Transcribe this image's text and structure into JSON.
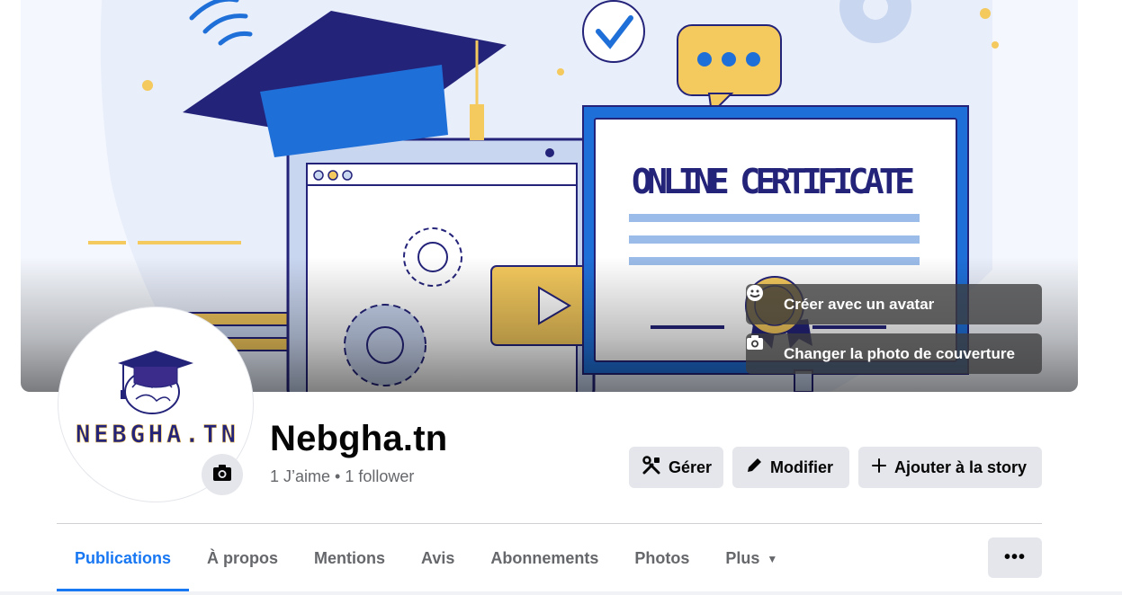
{
  "cover": {
    "certificate_title": "ONLINE CERTIFICATE",
    "avatar_button_label": "Créer avec un avatar",
    "change_cover_label": "Changer la photo de couverture"
  },
  "profile": {
    "logo_text": "NEBGHA.TN",
    "name": "Nebgha.tn",
    "stats": "1 J’aime • 1 follower"
  },
  "actions": {
    "manage_label": "Gérer",
    "edit_label": "Modifier",
    "story_label": "Ajouter à la story"
  },
  "tabs": [
    {
      "label": "Publications",
      "active": true
    },
    {
      "label": "À propos"
    },
    {
      "label": "Mentions"
    },
    {
      "label": "Avis"
    },
    {
      "label": "Abonnements"
    },
    {
      "label": "Photos"
    },
    {
      "label": "Plus"
    }
  ],
  "more_button_label": "•••",
  "colors": {
    "accent": "#1877f2",
    "button_bg": "#e4e6eb",
    "navy": "#24237a",
    "blue": "#1f6fd8",
    "gold": "#f4c95d"
  }
}
